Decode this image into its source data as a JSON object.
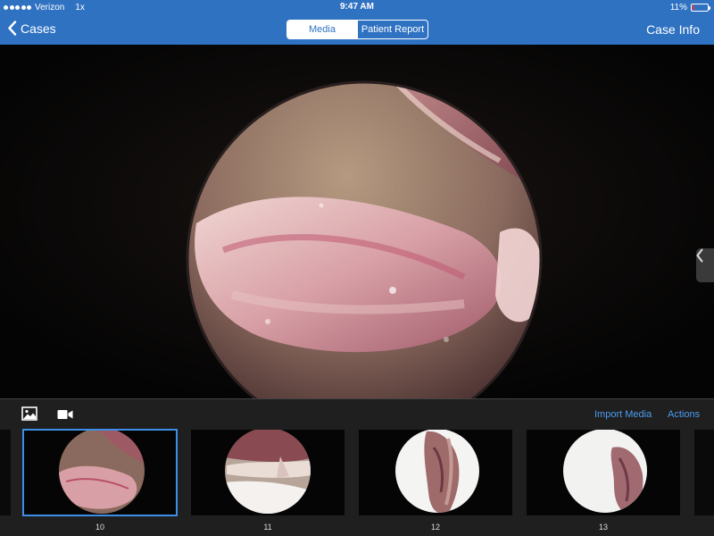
{
  "status_bar": {
    "carrier": "Verizon",
    "speed": "1x",
    "time": "9:47 AM",
    "battery_percent": "11%",
    "battery_level": 0.11
  },
  "nav": {
    "back_label": "Cases",
    "tabs": [
      {
        "label": "Media",
        "active": true
      },
      {
        "label": "Patient Report",
        "active": false
      }
    ],
    "right_label": "Case Info"
  },
  "toolbar": {
    "photo_icon": "photo-icon",
    "video_icon": "video-camera-icon",
    "import_label": "Import Media",
    "actions_label": "Actions"
  },
  "thumbnails": [
    {
      "label": "10",
      "selected": true
    },
    {
      "label": "11",
      "selected": false
    },
    {
      "label": "12",
      "selected": false
    },
    {
      "label": "13",
      "selected": false
    }
  ],
  "colors": {
    "nav_blue": "#2f72c2",
    "link_blue": "#4b9cf0",
    "selection_blue": "#3d8ee6"
  }
}
